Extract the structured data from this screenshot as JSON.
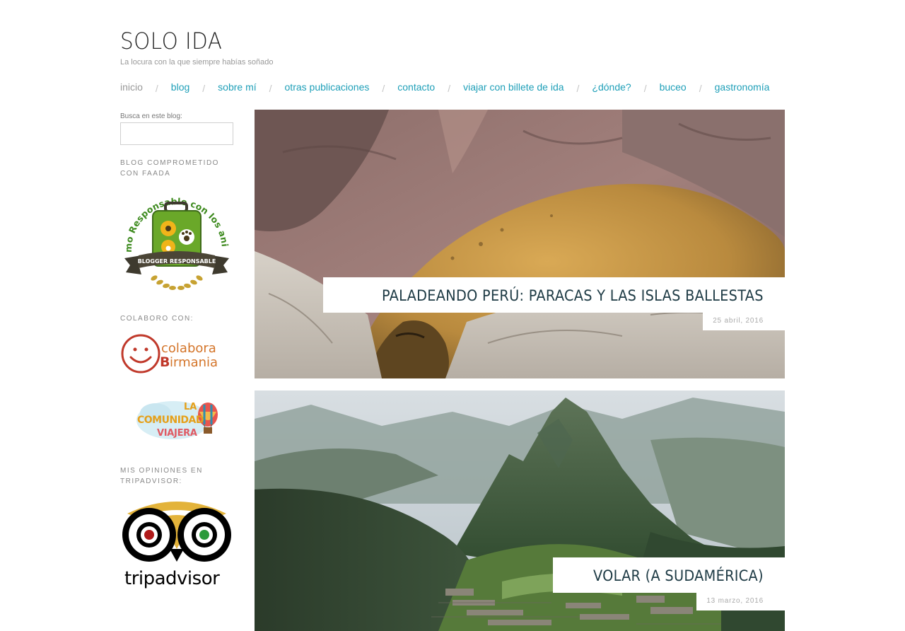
{
  "site": {
    "title": "SOLO IDA",
    "tagline": "La locura con la que siempre habías soñado"
  },
  "nav": {
    "items": [
      {
        "label": "inicio",
        "current": true
      },
      {
        "label": "blog"
      },
      {
        "label": "sobre mí"
      },
      {
        "label": "otras publicaciones"
      },
      {
        "label": "contacto"
      },
      {
        "label": "viajar con billete de ida"
      },
      {
        "label": "¿dónde?"
      },
      {
        "label": "buceo"
      },
      {
        "label": "gastronomía"
      }
    ],
    "separator": "/",
    "link_color": "#1e9fb8"
  },
  "sidebar": {
    "search_label": "Busca en este blog:",
    "search_value": "",
    "widget_faada_title": "BLOG COMPROMETIDO CON FAADA",
    "faada_badge": {
      "top_text": "Turismo Responsable con los animales",
      "banner_text": "BLOGGER RESPONSABLE",
      "icon": "suitcase-paw-icon"
    },
    "widget_colaboro_title": "COLABORO CON:",
    "colabora_logo": {
      "line1": "colabora",
      "line2": "irmania",
      "initial": "B"
    },
    "comunidad_logo": {
      "line1": "LA",
      "line2": "COMUNIDAD",
      "line3": "VIAJERA"
    },
    "widget_tripadvisor_title": "MIS OPINIONES EN TRIPADVISOR:",
    "tripadvisor_logo": {
      "text": "tripadvisor",
      "icon": "owl-icon"
    }
  },
  "posts": [
    {
      "title": "PALADEANDO PERÚ: PARACAS Y LAS ISLAS BALLESTAS",
      "date": "25 abril, 2016",
      "image": "sea-lion-photo"
    },
    {
      "title": "VOLAR (A SUDAMÉRICA)",
      "date": "13 marzo, 2016",
      "image": "machu-picchu-photo"
    }
  ],
  "colors": {
    "title_text": "#1d3a44",
    "accent": "#1e9fb8"
  }
}
